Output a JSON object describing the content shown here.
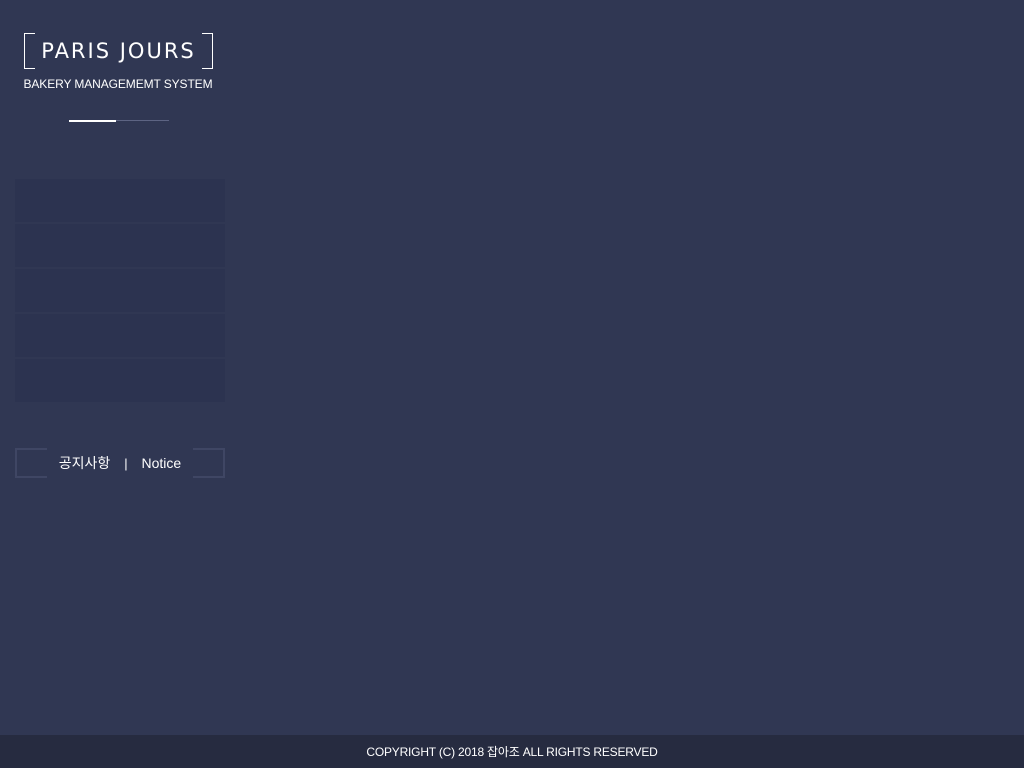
{
  "brand": {
    "logo_text": "PARIS JOURS",
    "subtitle": "BAKERY MANAGEMEMT SYSTEM"
  },
  "sidebar": {
    "menu_items": [
      {
        "label": ""
      },
      {
        "label": ""
      },
      {
        "label": ""
      },
      {
        "label": ""
      },
      {
        "label": ""
      }
    ],
    "notice": {
      "korean": "공지사항",
      "separator": "|",
      "english": "Notice"
    }
  },
  "footer": {
    "copyright": "COPYRIGHT (C) 2018 잡아조 ALL RIGHTS RESERVED"
  },
  "colors": {
    "background": "#303753",
    "menu_item": "#2c3350",
    "footer": "#262b40",
    "text": "#ffffff"
  }
}
